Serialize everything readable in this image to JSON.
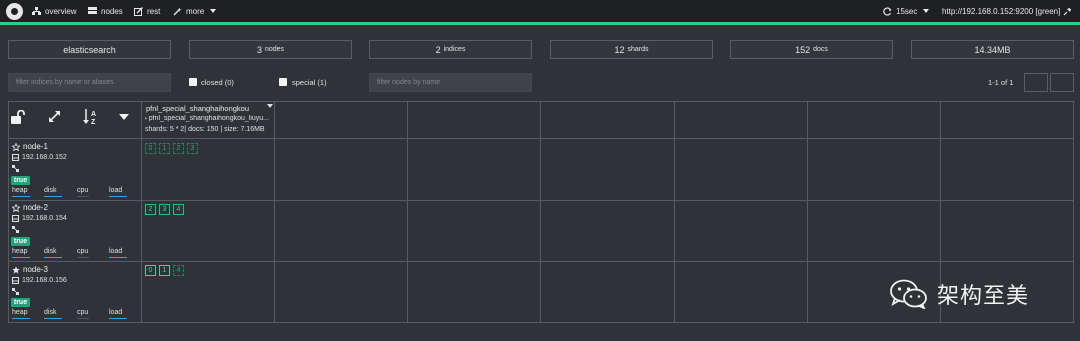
{
  "nav": {
    "overview": "overview",
    "nodes": "nodes",
    "rest": "rest",
    "more": "more",
    "refresh": "15sec",
    "cluster_url": "http://192.168.0.152:9200 [green]"
  },
  "stats": {
    "cluster_name": "elasticsearch",
    "nodes_value": "3",
    "nodes_unit": "nodes",
    "indices_value": "2",
    "indices_unit": "indices",
    "shards_value": "12",
    "shards_unit": "shards",
    "docs_value": "152",
    "docs_unit": "docs",
    "size": "14.34MB"
  },
  "filters": {
    "indices_placeholder": "filter indices by name or aliases",
    "closed_label": "closed (0)",
    "special_label": "special (1)",
    "nodes_placeholder": "filter nodes by name",
    "pagination": "1-1 of 1"
  },
  "index": {
    "name": "pfnl_special_shanghaihongkou",
    "alias": "pfnl_special_shanghaihongkou_liuyu...",
    "stats": "shards: 5 * 2| docs: 150 | size: 7.16MB"
  },
  "metrics": {
    "heap": "heap",
    "disk": "disk",
    "cpu": "cpu",
    "load": "load"
  },
  "nodes": [
    {
      "name": "node-1",
      "ip": "192.168.0.152",
      "badge": "true",
      "shards": [
        "0",
        "1",
        "2",
        "3"
      ]
    },
    {
      "name": "node-2",
      "ip": "192.168.0.154",
      "badge": "true",
      "shards": [
        "2",
        "3",
        "4"
      ]
    },
    {
      "name": "node-3",
      "ip": "192.168.0.156",
      "badge": "true",
      "shards": [
        "0",
        "1",
        "4"
      ]
    }
  ],
  "watermark": "架构至美",
  "colors": {
    "accent": "#2ecc8e",
    "shard": "#3fd39b",
    "badge": "#1fa67a",
    "metric_bar": "#3aa1e0"
  }
}
